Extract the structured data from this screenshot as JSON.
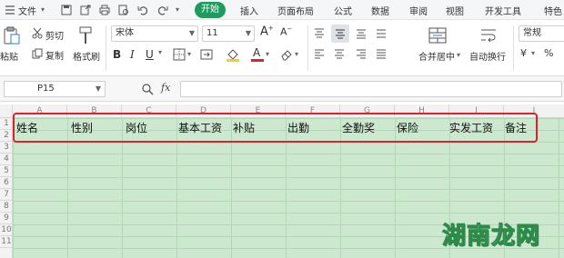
{
  "menubar": {
    "file_label": "文件",
    "tabs": [
      "开始",
      "插入",
      "页面布局",
      "公式",
      "数据",
      "审阅",
      "视图",
      "开发工具",
      "特色"
    ]
  },
  "toolbar": {
    "paste_label": "粘贴",
    "cut_label": "剪切",
    "copy_label": "复制",
    "format_painter_label": "格式刷",
    "font_name": "宋体",
    "font_size": "11",
    "merge_label": "合并居中",
    "wrap_label": "自动换行",
    "number_format": "常规"
  },
  "formula_bar": {
    "cell_ref": "P15",
    "fx_label": "fx"
  },
  "sheet": {
    "columns": [
      "A",
      "B",
      "C",
      "D",
      "E",
      "F",
      "G",
      "H",
      "I",
      "J"
    ],
    "rows": [
      "1",
      "2",
      "3",
      "4",
      "5",
      "6",
      "7",
      "8",
      "9",
      "10",
      "11"
    ],
    "header_cells": [
      "姓名",
      "性别",
      "岗位",
      "基本工资",
      "补贴",
      "出勤",
      "全勤奖",
      "保险",
      "实发工资",
      "备注"
    ]
  },
  "watermark": "湖南龙网",
  "colors": {
    "accent": "#1d9c60",
    "grid_fill": "#cce8cf",
    "highlight_box": "#e0202a"
  }
}
